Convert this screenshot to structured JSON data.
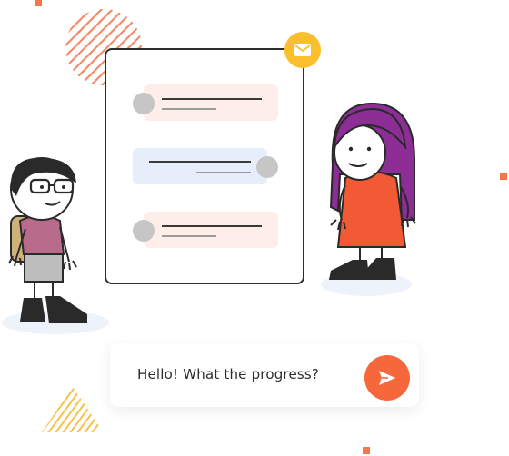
{
  "chat_card": {
    "badge_icon": "mail-icon",
    "bubbles": [
      {
        "side": "left",
        "color": "#fdeeea"
      },
      {
        "side": "right",
        "color": "#e6edfb"
      },
      {
        "side": "left",
        "color": "#fdeeea"
      }
    ]
  },
  "message_bar": {
    "text": "Hello! What the progress?",
    "send_icon": "send-icon",
    "send_color": "#f6683c"
  },
  "colors": {
    "accent": "#f4774a",
    "badge": "#fbbf2e",
    "bubble_in": "#fdeeea",
    "bubble_out": "#e6edfb"
  }
}
